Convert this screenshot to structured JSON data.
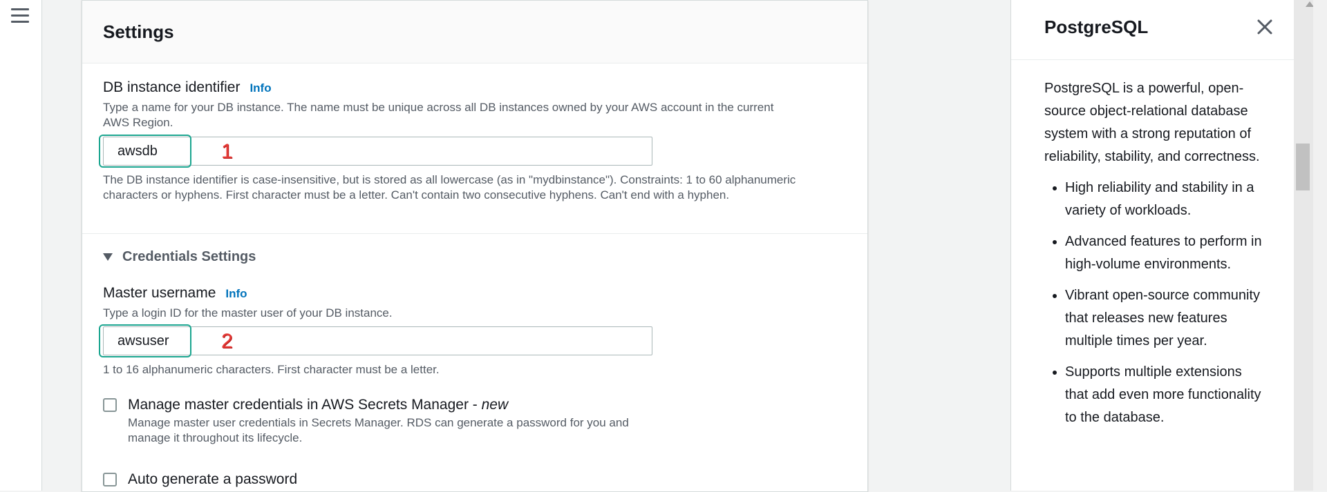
{
  "settings": {
    "title": "Settings",
    "db_identifier": {
      "label": "DB instance identifier",
      "info": "Info",
      "description": "Type a name for your DB instance. The name must be unique across all DB instances owned by your AWS account in the current AWS Region.",
      "value": "awsdb",
      "constraints": "The DB instance identifier is case-insensitive, but is stored as all lowercase (as in \"mydbinstance\"). Constraints: 1 to 60 alphanumeric characters or hyphens. First character must be a letter. Can't contain two consecutive hyphens. Can't end with a hyphen.",
      "annotation": "1"
    },
    "credentials": {
      "title": "Credentials Settings",
      "master_username": {
        "label": "Master username",
        "info": "Info",
        "description": "Type a login ID for the master user of your DB instance.",
        "value": "awsuser",
        "constraints": "1 to 16 alphanumeric characters. First character must be a letter.",
        "annotation": "2"
      },
      "manage_secrets": {
        "label": "Manage master credentials in AWS Secrets Manager - ",
        "label_new": "new",
        "description": "Manage master user credentials in Secrets Manager. RDS can generate a password for you and manage it throughout its lifecycle.",
        "checked": false
      },
      "auto_password": {
        "label": "Auto generate a password",
        "checked": false
      }
    }
  },
  "help": {
    "title": "PostgreSQL",
    "intro": "PostgreSQL is a powerful, open-source object-relational database system with a strong reputation of reliability, stability, and correctness.",
    "bullets": [
      "High reliability and stability in a variety of workloads.",
      "Advanced features to perform in high-volume environments.",
      "Vibrant open-source community that releases new features multiple times per year.",
      "Supports multiple extensions that add even more functionality to the database."
    ]
  },
  "colors": {
    "accent_link": "#0073bb",
    "highlight": "#1aa58f",
    "annotation": "#e53935"
  },
  "icons": {
    "menu": "hamburger-menu-icon",
    "close": "close-icon",
    "collapse": "triangle-down-icon"
  }
}
